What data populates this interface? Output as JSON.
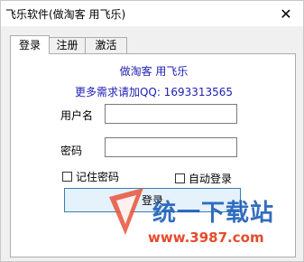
{
  "window": {
    "title": "飞乐软件(做淘客 用飞乐)",
    "close_glyph": "✕"
  },
  "tabs": [
    {
      "label": "登录",
      "active": true
    },
    {
      "label": "注册",
      "active": false
    },
    {
      "label": "激活",
      "active": false
    }
  ],
  "brand": {
    "line1": "做淘客 用飞乐",
    "line2": "更多需求请加QQ: 1693313565",
    "color": "#1e1eb4"
  },
  "form": {
    "username_label": "用户名",
    "username_value": "",
    "password_label": "密码",
    "password_value": "",
    "remember_label": "记住密码",
    "auto_login_label": "自动登录",
    "login_button": "登录"
  },
  "watermark": {
    "text": "统一下载站",
    "url": "www.3987.com"
  }
}
